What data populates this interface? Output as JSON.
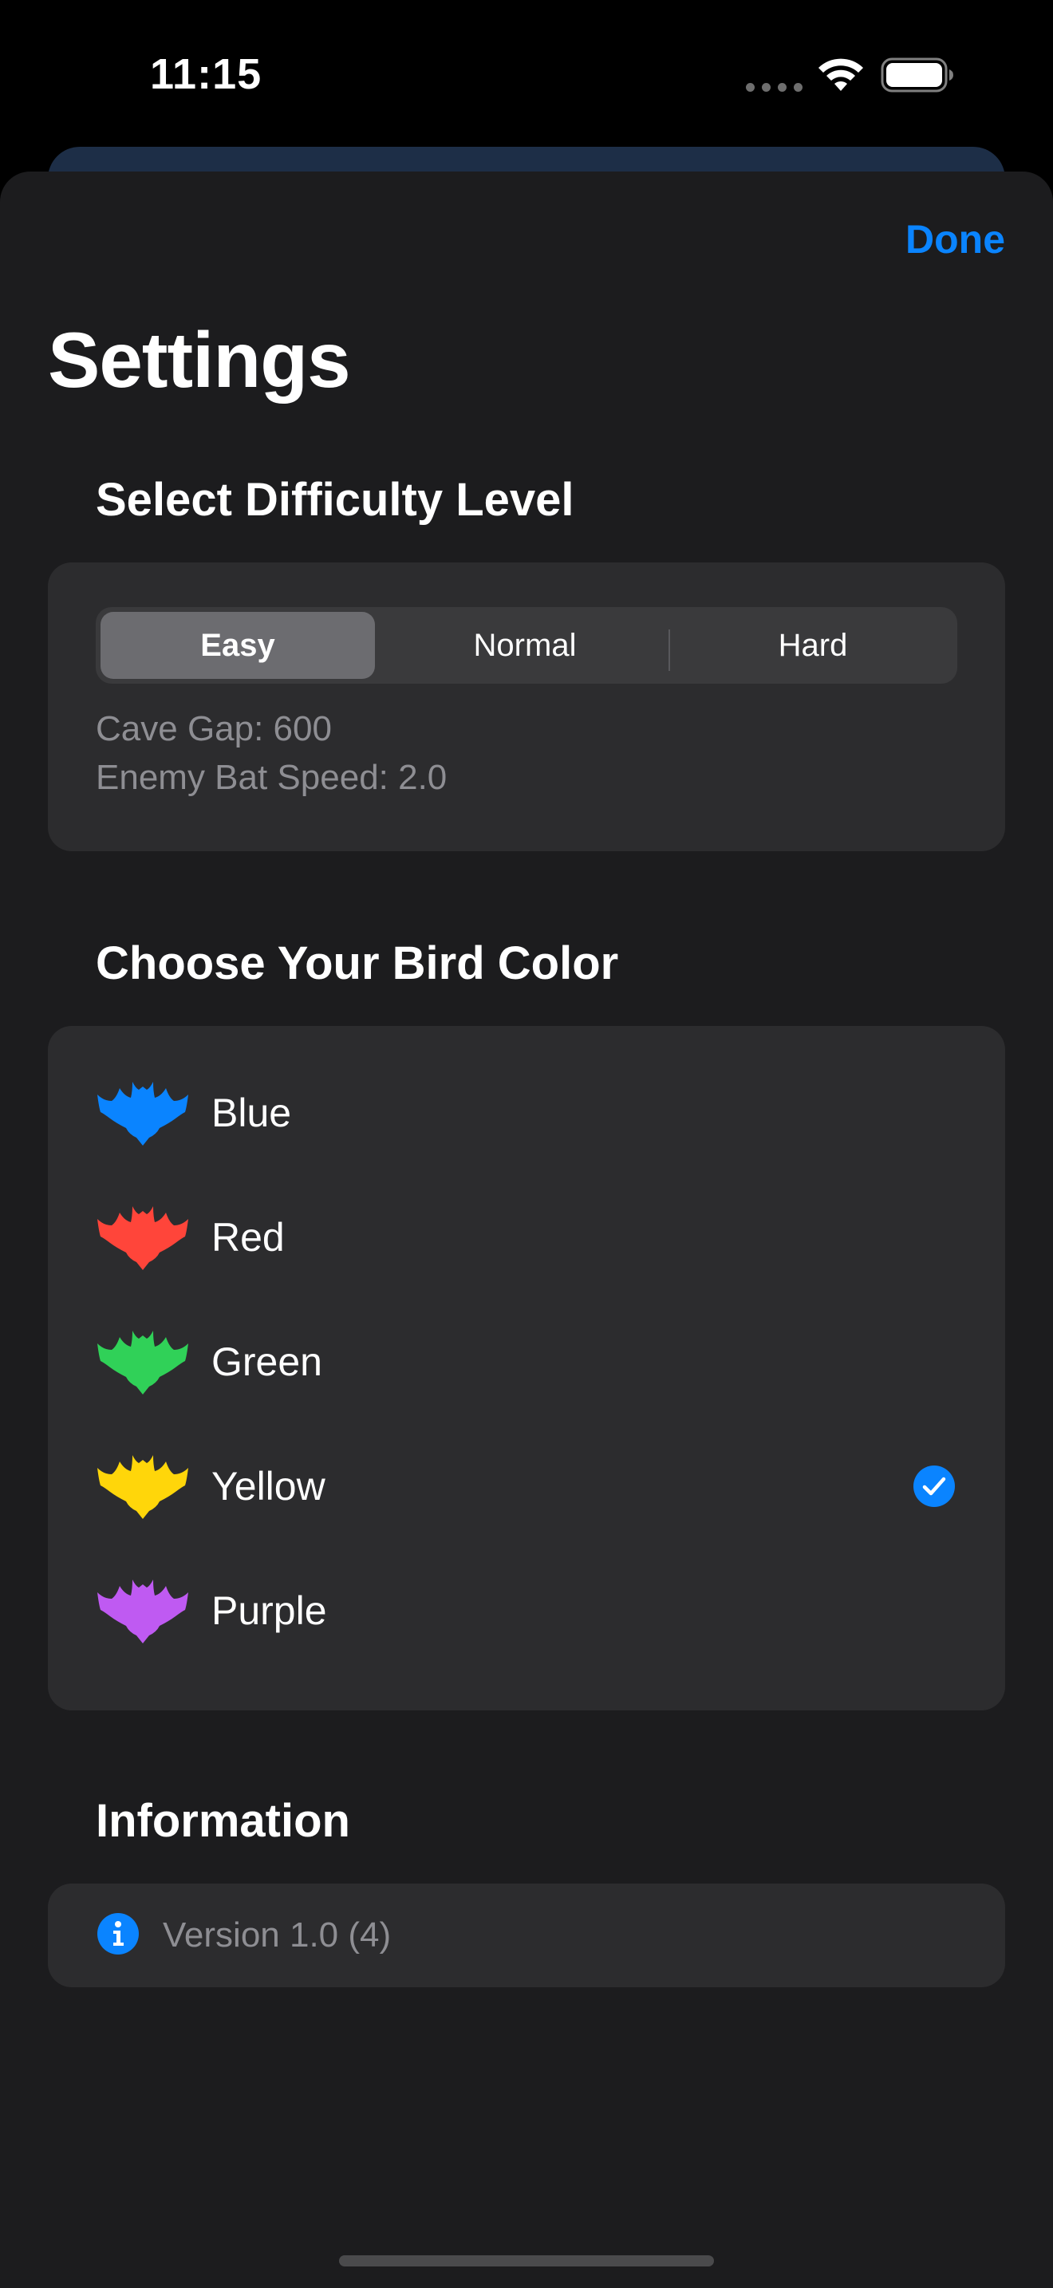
{
  "status_bar": {
    "time": "11:15"
  },
  "header": {
    "done_label": "Done",
    "title": "Settings"
  },
  "difficulty": {
    "header": "Select Difficulty Level",
    "segments": [
      "Easy",
      "Normal",
      "Hard"
    ],
    "selected": "Easy",
    "cave_gap": "Cave Gap: 600",
    "enemy_bat_speed": "Enemy Bat Speed: 2.0"
  },
  "bird_color": {
    "header": "Choose Your Bird Color",
    "options": [
      {
        "label": "Blue",
        "color": "#0a84ff",
        "icon": "bat-icon"
      },
      {
        "label": "Red",
        "color": "#ff453a",
        "icon": "bat-icon"
      },
      {
        "label": "Green",
        "color": "#30d158",
        "icon": "bat-icon"
      },
      {
        "label": "Yellow",
        "color": "#ffd60a",
        "icon": "bat-icon"
      },
      {
        "label": "Purple",
        "color": "#bf5af2",
        "icon": "bat-icon"
      }
    ],
    "selected": "Yellow"
  },
  "information": {
    "header": "Information",
    "version": "Version 1.0 (4)",
    "icon": "info-icon"
  },
  "colors": {
    "accent": "#0a84ff",
    "sheet_background": "#1c1c1e",
    "card_background": "#2c2c2e",
    "secondary_text": "#8e8e93"
  }
}
